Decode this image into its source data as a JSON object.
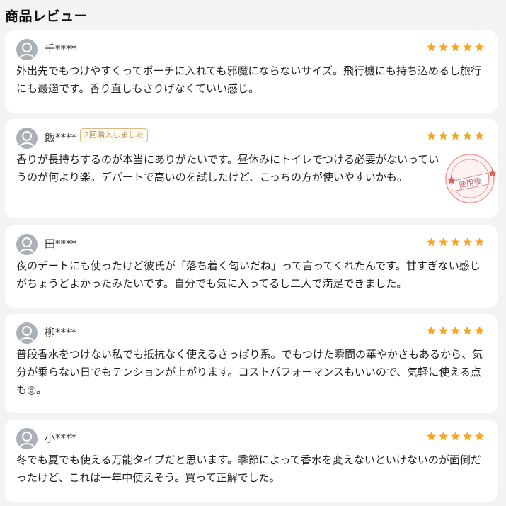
{
  "page_title": "商品レビュー",
  "star_color": "#f5a623",
  "reviews": [
    {
      "user": "千****",
      "rating": 5,
      "text": "外出先でもつけやすくってポーチに入れても邪魔にならないサイズ。飛行機にも持ち込めるし旅行にも最適です。香り直しもさりげなくていい感じ。"
    },
    {
      "user": "飯****",
      "badge": "2回購入しました",
      "rating": 5,
      "text": "香りが長持ちするのが本当にありがたいです。昼休みにトイレでつける必要がないっていうのが何より楽。デパートで高いのを試したけど、こっちの方が使いやすいかも。",
      "stamp_text": "使用後"
    },
    {
      "user": "田****",
      "rating": 5,
      "text": "夜のデートにも使ったけど彼氏が「落ち着く匂いだね」って言ってくれたんです。甘すぎない感じがちょうどよかったみたいです。自分でも気に入ってるし二人で満足できました。"
    },
    {
      "user": "柳****",
      "rating": 5,
      "text": "普段香水をつけない私でも抵抗なく使えるさっぱり系。でもつけた瞬間の華やかさもあるから、気分が乗らない日でもテンションが上がります。コストパフォーマンスもいいので、気軽に使える点も◎。"
    },
    {
      "user": "小****",
      "rating": 5,
      "text": "冬でも夏でも使える万能タイプだと思います。季節によって香水を変えないといけないのが面倒だったけど、これは一年中使えそう。買って正解でした。"
    }
  ]
}
